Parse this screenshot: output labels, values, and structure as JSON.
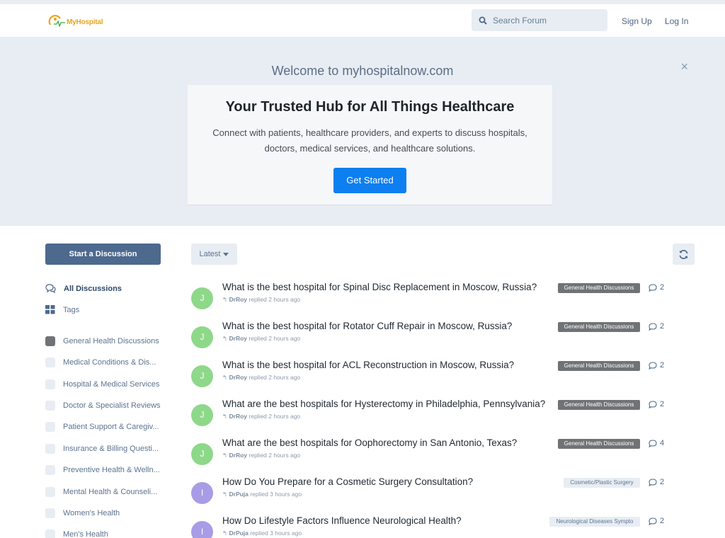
{
  "header": {
    "logo_text": "MyHospital",
    "search_placeholder": "Search Forum",
    "sign_up": "Sign Up",
    "log_in": "Log In"
  },
  "hero": {
    "welcome": "Welcome to myhospitalnow.com",
    "close": "×",
    "title": "Your Trusted Hub for All Things Healthcare",
    "text": "Connect with patients, healthcare providers, and experts to discuss hospitals, doctors, medical services, and healthcare solutions.",
    "cta": "Get Started"
  },
  "sidebar": {
    "start_discussion": "Start a Discussion",
    "all_discussions": "All Discussions",
    "tags": "Tags",
    "categories": [
      "General Health Discussions",
      "Medical Conditions & Dis...",
      "Hospital & Medical Services",
      "Doctor & Specialist Reviews",
      "Patient Support & Caregiv...",
      "Insurance & Billing Questi...",
      "Preventive Health & Welln...",
      "Mental Health & Counseli...",
      "Women's Health",
      "Men's Health"
    ]
  },
  "toolbar": {
    "sort_label": "Latest"
  },
  "discussions": [
    {
      "initial": "J",
      "title": "What is the best hospital for Spinal Disc Replacement in Moscow, Russia?",
      "user": "DrRoy",
      "action": "replied 2 hours ago",
      "tag": "General Health Discussions",
      "replies": "2"
    },
    {
      "initial": "J",
      "title": "What is the best hospital for Rotator Cuff Repair in Moscow, Russia?",
      "user": "DrRoy",
      "action": "replied 2 hours ago",
      "tag": "General Health Discussions",
      "replies": "2"
    },
    {
      "initial": "J",
      "title": "What is the best hospital for ACL Reconstruction in Moscow, Russia?",
      "user": "DrRoy",
      "action": "replied 2 hours ago",
      "tag": "General Health Discussions",
      "replies": "2"
    },
    {
      "initial": "J",
      "title": "What are the best hospitals for Hysterectomy in Philadelphia, Pennsylvania?",
      "user": "DrRoy",
      "action": "replied 2 hours ago",
      "tag": "General Health Discussions",
      "replies": "2"
    },
    {
      "initial": "J",
      "title": "What are the best hospitals for Oophorectomy in San Antonio, Texas?",
      "user": "DrRoy",
      "action": "replied 2 hours ago",
      "tag": "General Health Discussions",
      "replies": "4"
    },
    {
      "initial": "I",
      "title": "How Do You Prepare for a Cosmetic Surgery Consultation?",
      "user": "DrPuja",
      "action": "replied 3 hours ago",
      "tag": "Cosmetic/Plastic Surgery",
      "replies": "2"
    },
    {
      "initial": "I",
      "title": "How Do Lifestyle Factors Influence Neurological Health?",
      "user": "DrPuja",
      "action": "replied 3 hours ago",
      "tag": "Neurological Diseases Sympto",
      "replies": "2"
    }
  ],
  "colors": {
    "accent": "#0d7ff0",
    "primary": "#4d698e",
    "avatar_j": "#8ed88a",
    "avatar_i": "#a99ce6"
  }
}
